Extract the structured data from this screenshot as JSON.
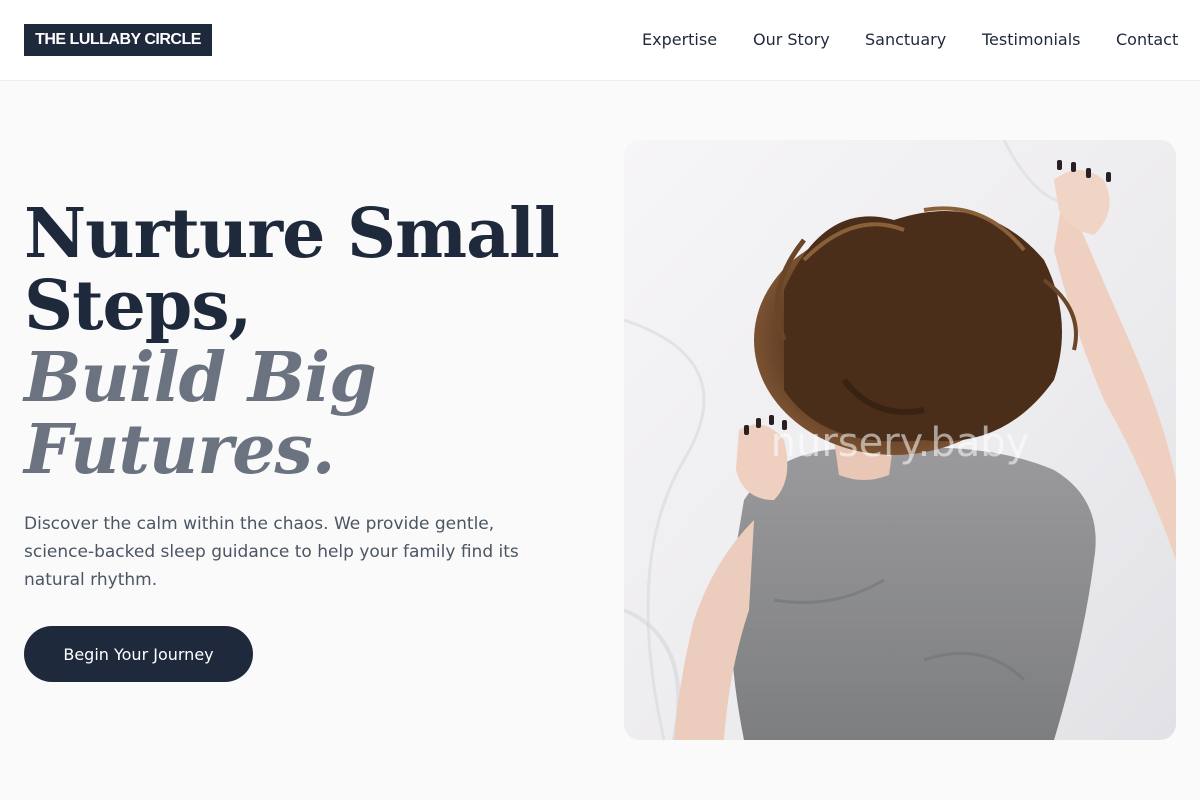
{
  "brand": {
    "logo_text": "THE LULLABY CIRCLE"
  },
  "nav": {
    "items": [
      {
        "label": "Expertise"
      },
      {
        "label": "Our Story"
      },
      {
        "label": "Sanctuary"
      },
      {
        "label": "Testimonials"
      },
      {
        "label": "Contact"
      }
    ]
  },
  "hero": {
    "title_lines": [
      "Nurture Small",
      "Steps,",
      "Build Big",
      "Futures."
    ],
    "description": "Discover the calm within the chaos. We provide gentle, science-backed sleep guidance to help your family find its natural rhythm.",
    "cta_label": "Begin Your Journey",
    "image": {
      "alt": "Woman sleeping face-down on white sheets",
      "watermark": "nursery.baby"
    }
  },
  "colors": {
    "primary": "#1e293b",
    "muted_heading": "#6b7280",
    "body_text": "#4b5563",
    "background": "#fafafa"
  }
}
